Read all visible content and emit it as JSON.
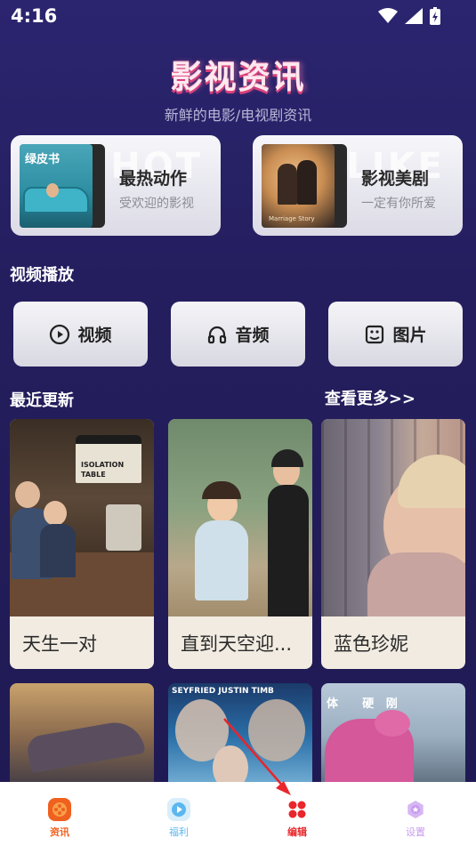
{
  "status": {
    "time": "4:16"
  },
  "header": {
    "title": "影视资讯",
    "subtitle": "新鲜的电影/电视剧资讯"
  },
  "features": [
    {
      "title": "最热动作",
      "subtitle": "受欢迎的影视",
      "ghost": "HOT",
      "poster_title": "绿皮书"
    },
    {
      "title": "影视美剧",
      "subtitle": "一定有你所爱",
      "ghost": "LIKE",
      "poster_title": "Marriage Story"
    }
  ],
  "media": {
    "section_title": "视频播放",
    "buttons": [
      {
        "label": "视频",
        "icon": "play-circle-icon"
      },
      {
        "label": "音频",
        "icon": "headphones-icon"
      },
      {
        "label": "图片",
        "icon": "image-icon"
      }
    ]
  },
  "recent": {
    "section_title": "最近更新",
    "see_more": "查看更多>>",
    "movies": [
      {
        "title": "天生一对",
        "sign": "ISOLATION TABLE"
      },
      {
        "title": "直到天空迎..."
      },
      {
        "title": "蓝色珍妮"
      }
    ],
    "more_posters": [
      {
        "caption": ""
      },
      {
        "caption": "SEYFRIED   JUSTIN TIMB"
      },
      {
        "caption": "体      硬   刚"
      }
    ]
  },
  "nav": {
    "items": [
      {
        "label": "资讯",
        "icon": "film-reel-icon",
        "color": "#f0601f"
      },
      {
        "label": "福利",
        "icon": "play-icon",
        "color": "#5cb7ef"
      },
      {
        "label": "编辑",
        "icon": "grid-icon",
        "color": "#e8262b"
      },
      {
        "label": "设置",
        "icon": "gear-icon",
        "color": "#c79bef"
      }
    ]
  }
}
